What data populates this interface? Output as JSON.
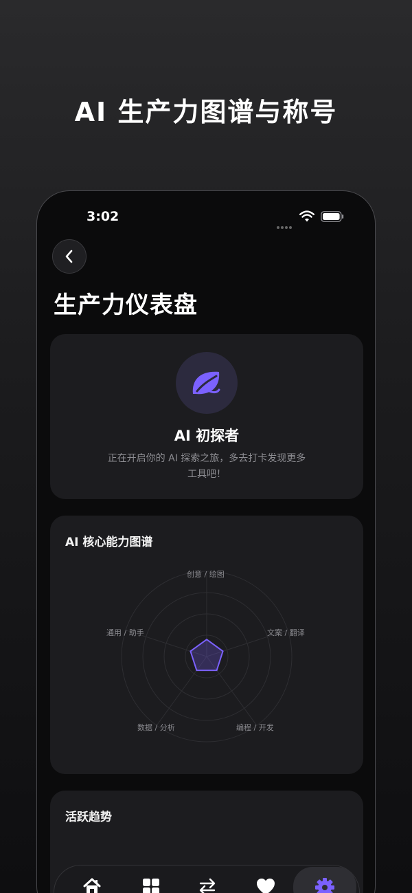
{
  "hero": {
    "title": "AI 生产力图谱与称号"
  },
  "status": {
    "time": "3:02"
  },
  "header": {
    "title": "生产力仪表盘"
  },
  "badge": {
    "name": "AI 初探者",
    "description": "正在开启你的 AI 探索之旅，多去打卡发现更多工具吧！",
    "icon": "leaf-icon",
    "accent": "#7b61ff"
  },
  "radar": {
    "title": "AI 核心能力图谱",
    "axes": [
      "创意 / 绘图",
      "文案 / 翻译",
      "编程 / 开发",
      "数据 / 分析",
      "通用 / 助手"
    ],
    "values": [
      0.2,
      0.2,
      0.2,
      0.2,
      0.2
    ],
    "accent": "#7b61ff"
  },
  "trend": {
    "title": "活跃趋势"
  },
  "tabs": [
    {
      "name": "home",
      "icon": "home-icon"
    },
    {
      "name": "grid",
      "icon": "grid-icon"
    },
    {
      "name": "swap",
      "icon": "swap-icon"
    },
    {
      "name": "favorites",
      "icon": "heart-icon"
    },
    {
      "name": "settings",
      "icon": "gear-icon",
      "active": true
    }
  ]
}
